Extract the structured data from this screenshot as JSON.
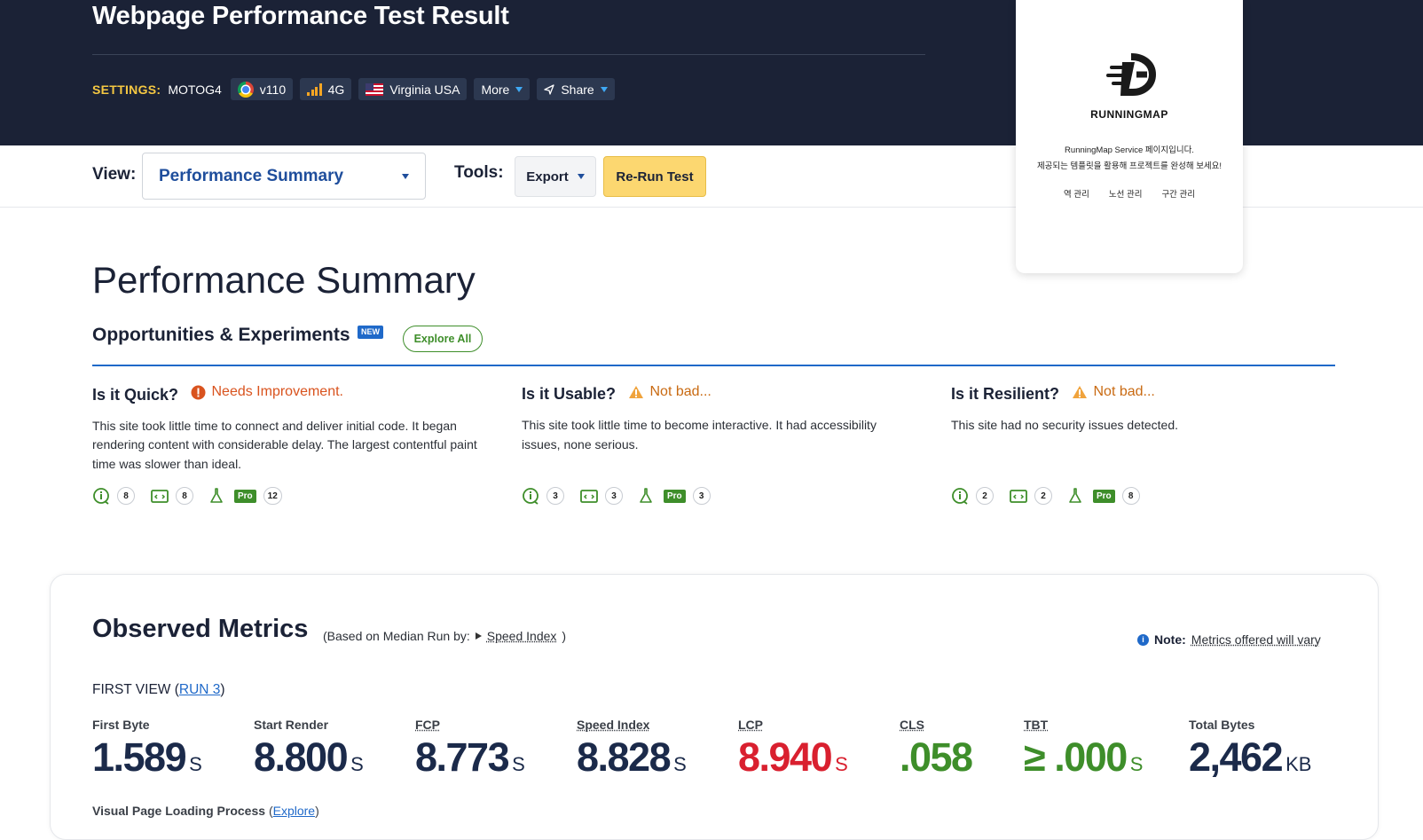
{
  "header": {
    "title": "Webpage Performance Test Result",
    "settings_label": "SETTINGS:",
    "device": "MOTOG4",
    "browser_version": "v110",
    "connection": "4G",
    "location": "Virginia USA",
    "more_label": "More",
    "share_label": "Share"
  },
  "toolbar": {
    "view_label": "View:",
    "view_selected": "Performance Summary",
    "tools_label": "Tools:",
    "export_label": "Export",
    "rerun_label": "Re-Run Test"
  },
  "popup": {
    "brand": "RUNNINGMAP",
    "line1": "RunningMap Service 페이지입니다.",
    "line2": "제공되는 템플릿을 활용해 프로젝트를 완성해 보세요!",
    "links": [
      "역 관리",
      "노선 관리",
      "구간 관리"
    ]
  },
  "summary": {
    "title": "Performance Summary",
    "ops_title": "Opportunities & Experiments",
    "new_badge": "NEW",
    "explore_all": "Explore All",
    "columns": [
      {
        "heading": "Is it Quick?",
        "status": "Needs Improvement.",
        "status_color": "#d9531e",
        "description": "This site took little time to connect and deliver initial code. It began rendering content with considerable delay. The largest contentful paint time was slower than ideal.",
        "counts": {
          "observations": "8",
          "tips": "8",
          "pro": "12"
        }
      },
      {
        "heading": "Is it Usable?",
        "status": "Not bad...",
        "status_color": "#c96a12",
        "description": "This site took little time to become interactive. It had accessibility issues, none serious.",
        "counts": {
          "observations": "3",
          "tips": "3",
          "pro": "3"
        }
      },
      {
        "heading": "Is it Resilient?",
        "status": "Not bad...",
        "status_color": "#c96a12",
        "description": "This site had no security issues detected.",
        "counts": {
          "observations": "2",
          "tips": "2",
          "pro": "8"
        }
      }
    ],
    "pro_label": "Pro"
  },
  "observed": {
    "title": "Observed Metrics",
    "subtitle_prefix": "(Based on Median Run by:",
    "subtitle_metric": "Speed Index",
    "subtitle_suffix": ")",
    "note_bold": "Note:",
    "note_text": "Metrics offered will vary",
    "first_view_prefix": "FIRST VIEW (",
    "first_view_run": "RUN 3",
    "first_view_suffix": ")",
    "metrics": [
      {
        "label": "First Byte",
        "value": "1.589",
        "unit": "S",
        "color": "#1b2a4a"
      },
      {
        "label": "Start Render",
        "value": "8.800",
        "unit": "S",
        "color": "#1b2a4a"
      },
      {
        "label": "FCP",
        "value": "8.773",
        "unit": "S",
        "color": "#1b2a4a"
      },
      {
        "label": "Speed Index",
        "value": "8.828",
        "unit": "S",
        "color": "#1b2a4a"
      },
      {
        "label": "LCP",
        "value": "8.940",
        "unit": "S",
        "color": "#d9202f"
      },
      {
        "label": "CLS",
        "value": ".058",
        "unit": "",
        "color": "#3e8e2a"
      },
      {
        "label": "TBT",
        "value": "≥ .000",
        "unit": "S",
        "color": "#3e8e2a"
      },
      {
        "label": "Total Bytes",
        "value": "2,462",
        "unit": "KB",
        "color": "#1b2a4a"
      }
    ],
    "visual_label": "Visual Page Loading Process",
    "visual_link": "Explore"
  }
}
